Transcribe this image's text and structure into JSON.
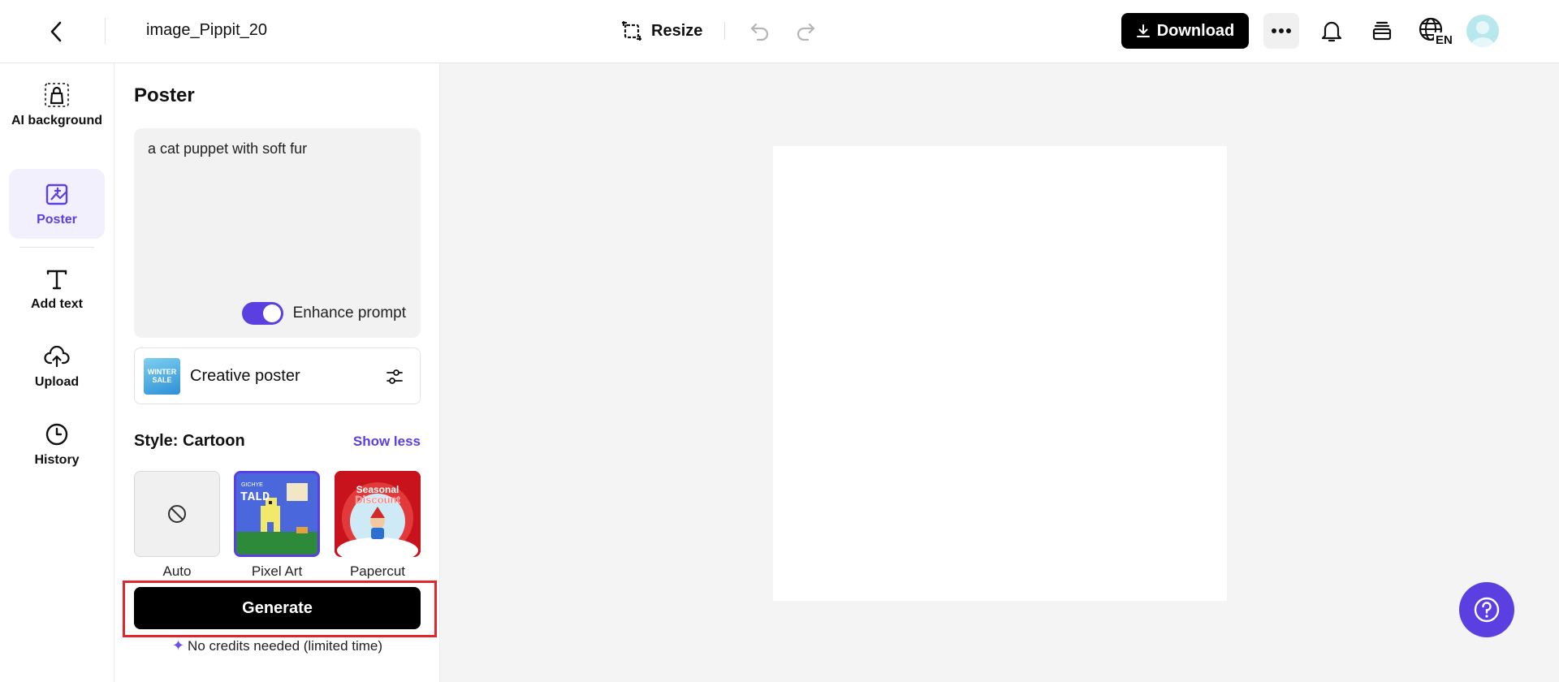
{
  "topbar": {
    "file_name": "image_Pippit_20",
    "resize_label": "Resize",
    "download_label": "Download",
    "language_badge": "EN"
  },
  "rail": {
    "items": [
      {
        "label": "AI background",
        "icon": "ai-background-icon"
      },
      {
        "label": "Poster",
        "icon": "poster-icon",
        "active": true
      },
      {
        "label": "Add text",
        "icon": "text-icon"
      },
      {
        "label": "Upload",
        "icon": "upload-icon"
      },
      {
        "label": "History",
        "icon": "history-icon"
      }
    ]
  },
  "panel": {
    "title": "Poster",
    "prompt_value": "a cat puppet with soft fur",
    "enhance_label": "Enhance prompt",
    "enhance_on": true,
    "poster_type_label": "Creative poster",
    "poster_type_thumb_text": "WINTER SALE",
    "style_label": "Style: Cartoon",
    "show_less_label": "Show less",
    "styles": [
      {
        "label": "Auto"
      },
      {
        "label": "Pixel Art",
        "thumb_text": "TALD",
        "thumb_small": "GICHYE",
        "selected": true
      },
      {
        "label": "Papercut",
        "thumb_text": "Seasonal",
        "thumb_text2": "Discount"
      }
    ],
    "generate_label": "Generate",
    "credits_text": "No credits needed (limited time)"
  },
  "colors": {
    "accent": "#5b3fe0",
    "highlight_outline": "#e3262c",
    "canvas_bg": "#ffffff",
    "workspace_bg": "#f4f4f4"
  }
}
